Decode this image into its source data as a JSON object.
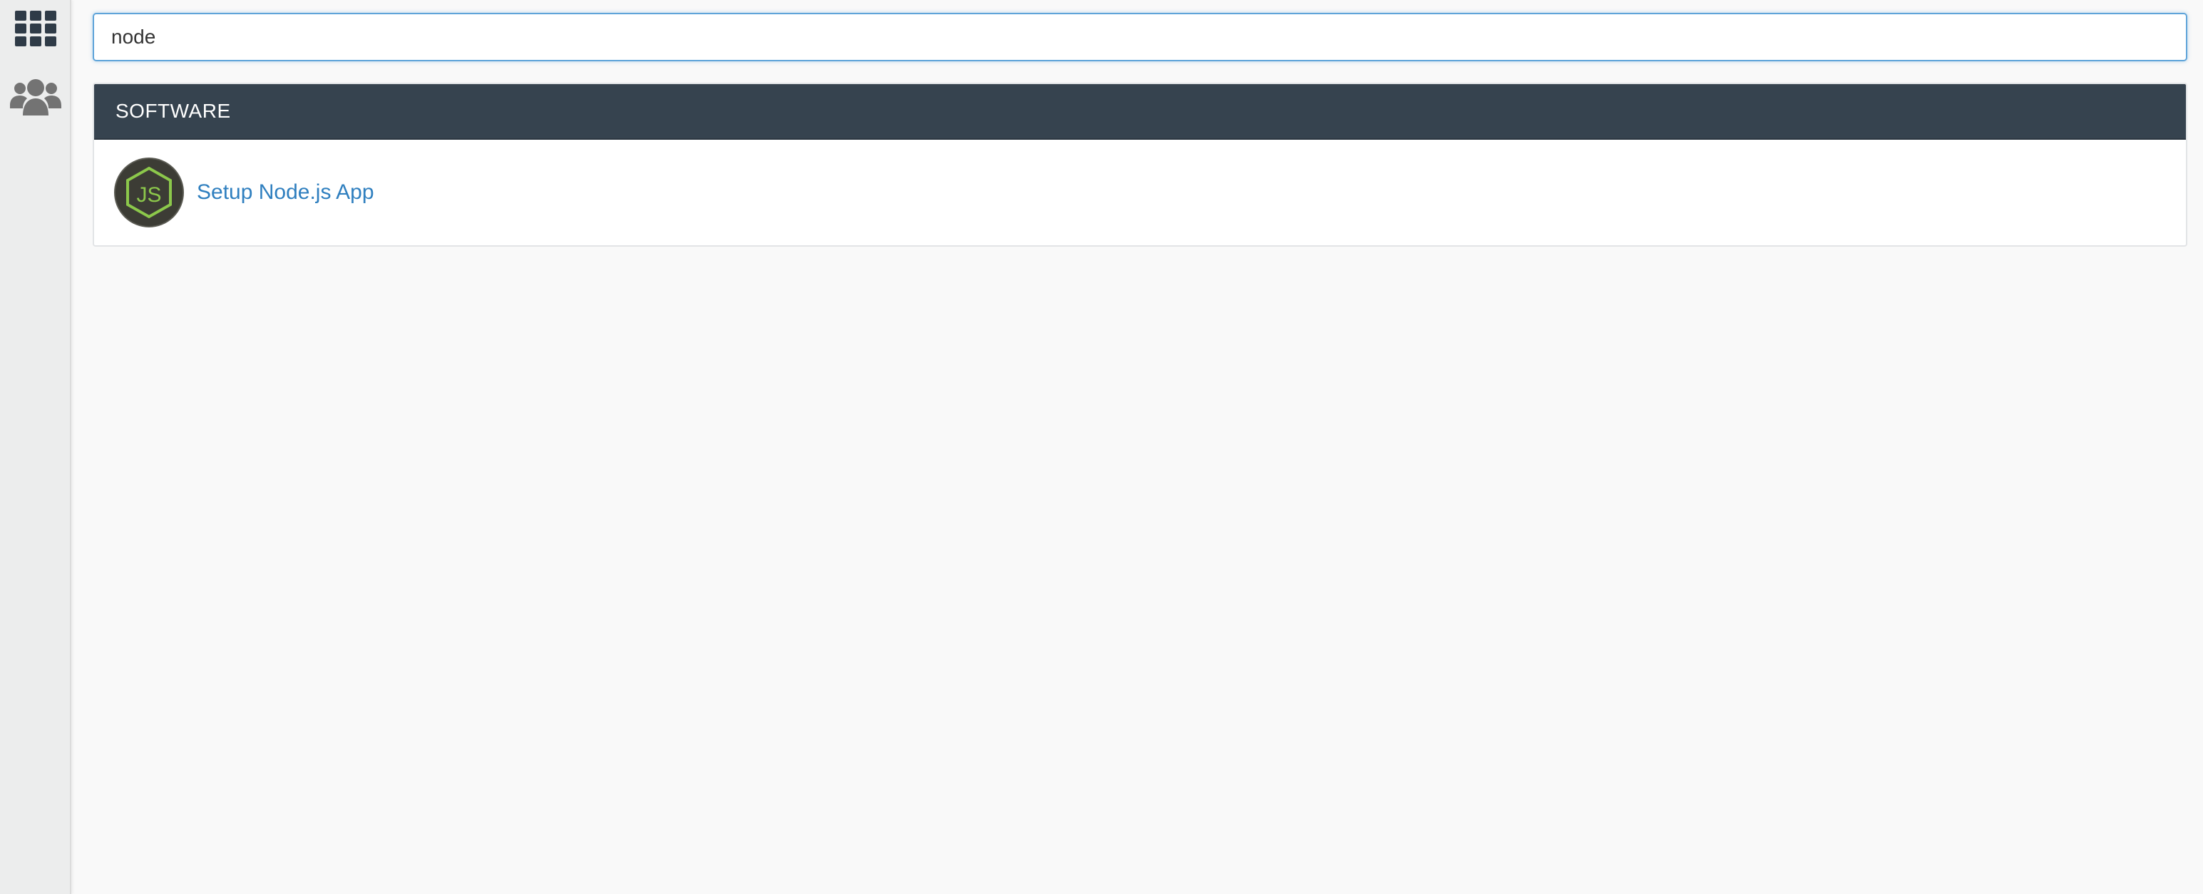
{
  "sidebar": {
    "items": [
      {
        "icon": "grid-icon",
        "label": "Tools"
      },
      {
        "icon": "users-icon",
        "label": "Users"
      }
    ]
  },
  "search": {
    "value": "node",
    "placeholder": ""
  },
  "results": {
    "section_title": "SOFTWARE",
    "items": [
      {
        "label": "Setup Node.js App",
        "icon": "nodejs-icon"
      }
    ]
  },
  "colors": {
    "header_bg": "#36434f",
    "link": "#2f7fbf",
    "search_focus": "#5fa4d9",
    "nodejs_green": "#8cc84b"
  }
}
